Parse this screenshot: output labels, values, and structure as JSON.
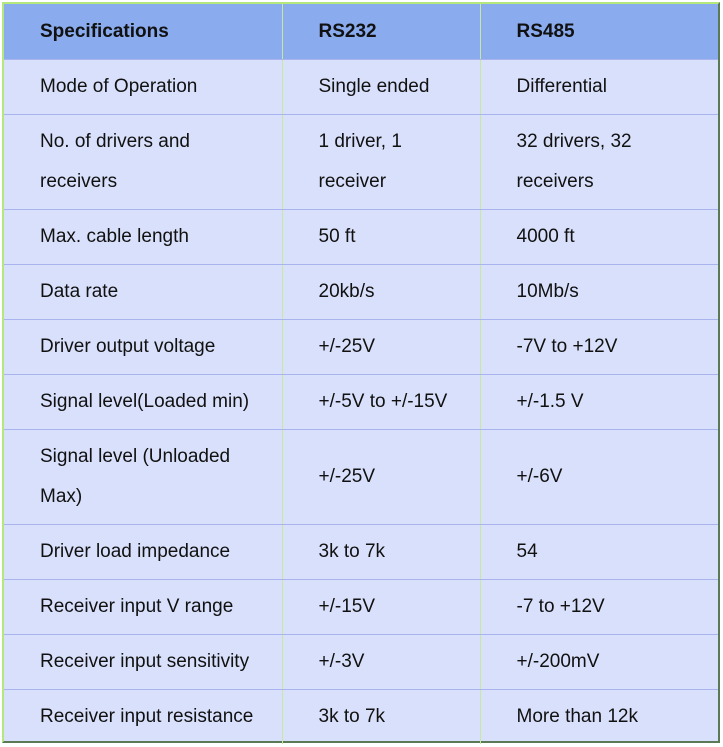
{
  "table": {
    "headers": [
      "Specifications",
      "RS232",
      "RS485"
    ],
    "rows": [
      [
        "Mode of Operation",
        "Single ended",
        "Differential"
      ],
      [
        "No. of drivers and receivers",
        "1 driver, 1 receiver",
        "32 drivers, 32 receivers"
      ],
      [
        "Max. cable length",
        "50 ft",
        "4000 ft"
      ],
      [
        "Data rate",
        "20kb/s",
        "10Mb/s"
      ],
      [
        "Driver output voltage",
        "+/-25V",
        "-7V to +12V"
      ],
      [
        "Signal level(Loaded min)",
        "+/-5V to +/-15V",
        "+/-1.5 V"
      ],
      [
        "Signal level (Unloaded Max)",
        "+/-25V",
        "+/-6V"
      ],
      [
        "Driver load impedance",
        "3k to 7k",
        "54"
      ],
      [
        "Receiver input V range",
        "+/-15V",
        "-7 to +12V"
      ],
      [
        "Receiver input sensitivity",
        "+/-3V",
        "+/-200mV"
      ],
      [
        "Receiver input resistance",
        "3k to 7k",
        "More than 12k"
      ]
    ]
  },
  "colors": {
    "header_bg": "#8aabee",
    "row_bg": "#d9e0fb",
    "row_divider": "#a9b4ee",
    "column_divider": "#c8e8a0"
  }
}
